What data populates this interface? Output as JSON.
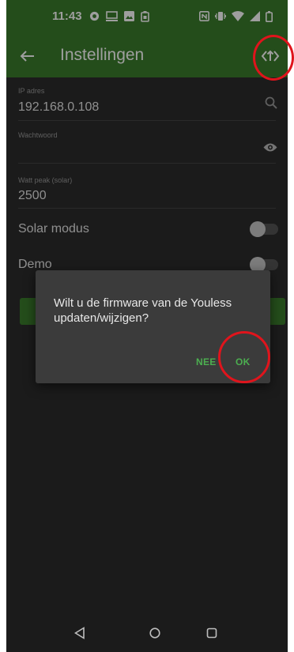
{
  "status_bar": {
    "time": "11:43",
    "left_icons": [
      "chrome-icon",
      "monitor-icon",
      "image-icon",
      "battery-saver-icon"
    ],
    "right_icons": [
      "nfc-icon",
      "vibrate-icon",
      "wifi-icon",
      "signal-icon",
      "battery-icon"
    ]
  },
  "app_bar": {
    "title": "Instellingen",
    "back_icon": "arrow-left-icon",
    "action_icon": "firmware-update-icon",
    "color": "#3a7d2c"
  },
  "form": {
    "ip": {
      "label": "IP adres",
      "value": "192.168.0.108",
      "icon": "search-icon"
    },
    "password": {
      "label": "Wachtwoord",
      "value": "",
      "icon": "eye-icon"
    },
    "watt_peak": {
      "label": "Watt peak (solar)",
      "value": "2500"
    },
    "solar_mode": {
      "label": "Solar modus",
      "enabled": false
    },
    "demo": {
      "label": "Demo",
      "enabled": false
    }
  },
  "dialog": {
    "message": "Wilt u de firmware van de Youless updaten/wijzigen?",
    "negative": "NEE",
    "positive": "OK",
    "button_color": "#4caf50"
  },
  "annotations": {
    "highlight_color": "#e0141c"
  },
  "nav_bar": {
    "icons": [
      "nav-back-icon",
      "nav-home-icon",
      "nav-recents-icon"
    ]
  }
}
